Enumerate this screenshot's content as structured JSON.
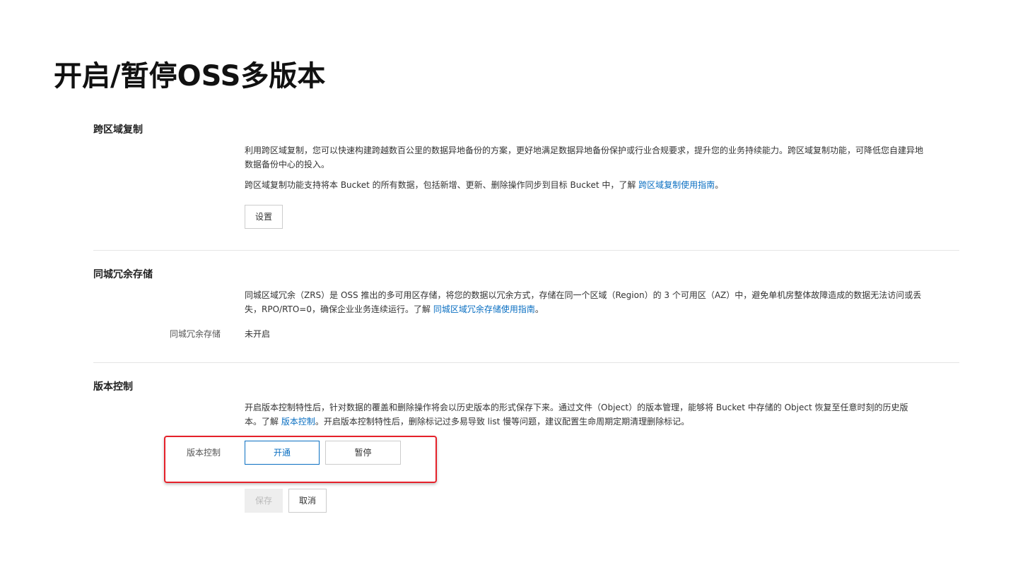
{
  "page_title": "开启/暂停OSS多版本",
  "colors": {
    "accent": "#0a6fc2",
    "highlight_border": "#e5212a",
    "divider": "#e5e5e5"
  },
  "crr": {
    "title": "跨区域复制",
    "desc1": "利用跨区域复制，您可以快速构建跨越数百公里的数据异地备份的方案，更好地满足数据异地备份保护或行业合规要求，提升您的业务持续能力。跨区域复制功能，可降低您自建异地数据备份中心的投入。",
    "desc2_prefix": "跨区域复制功能支持将本 Bucket 的所有数据，包括新增、更新、删除操作同步到目标 Bucket 中，了解 ",
    "desc2_link": "跨区域复制使用指南",
    "desc2_suffix": "。",
    "settings_button": "设置"
  },
  "zrs": {
    "title": "同城冗余存储",
    "desc_prefix": "同城区域冗余（ZRS）是 OSS 推出的多可用区存储，将您的数据以冗余方式，存储在同一个区域（Region）的 3 个可用区（AZ）中，避免单机房整体故障造成的数据无法访问或丢失，RPO/RTO=0，确保企业业务连续运行。了解 ",
    "desc_link": "同城区域冗余存储使用指南",
    "desc_suffix": "。",
    "field_label": "同城冗余存储",
    "field_value": "未开启"
  },
  "versioning": {
    "title": "版本控制",
    "desc_prefix": "开启版本控制特性后，针对数据的覆盖和删除操作将会以历史版本的形式保存下来。通过文件（Object）的版本管理，能够将 Bucket 中存储的 Object 恢复至任意时刻的历史版本。了解 ",
    "desc_link": "版本控制",
    "desc_suffix": "。开启版本控制特性后，删除标记过多易导致 list 慢等问题，建议配置生命周期定期清理删除标记。",
    "field_label": "版本控制",
    "option_enable": "开通",
    "option_pause": "暂停",
    "selected": "开通",
    "save_button": "保存",
    "cancel_button": "取消"
  }
}
